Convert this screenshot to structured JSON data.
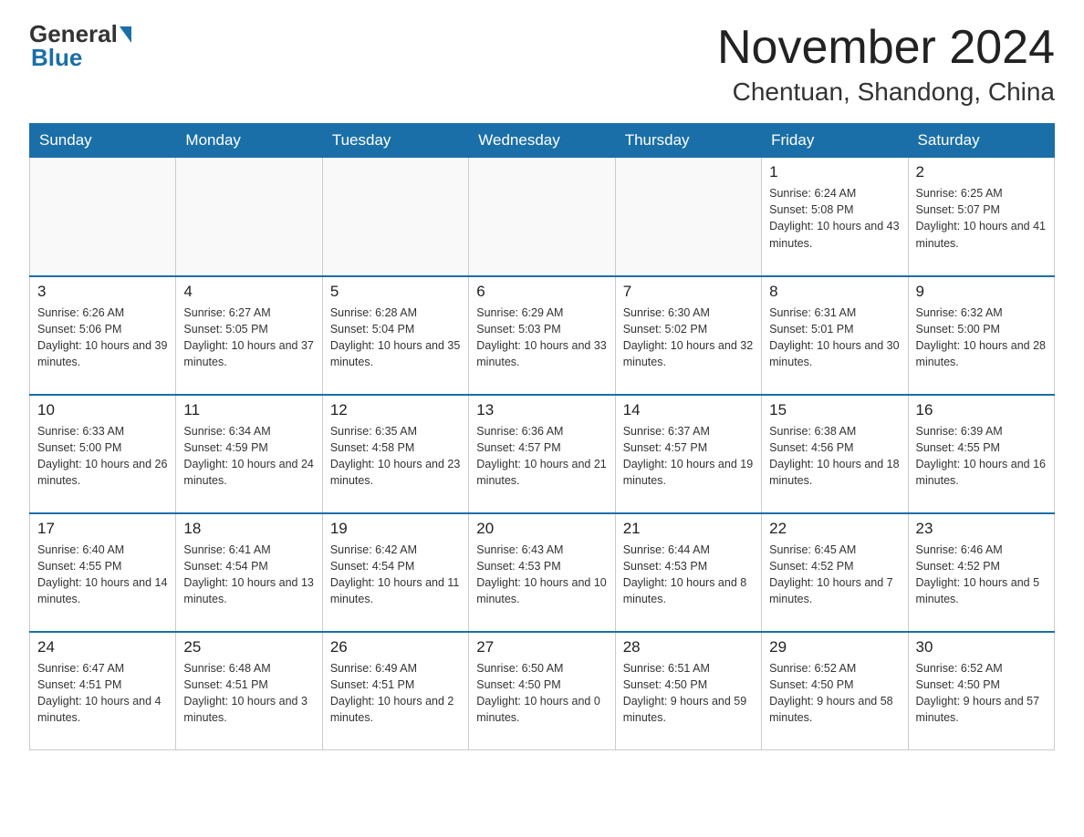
{
  "header": {
    "logo_general": "General",
    "logo_blue": "Blue",
    "title": "November 2024",
    "subtitle": "Chentuan, Shandong, China"
  },
  "calendar": {
    "days_of_week": [
      "Sunday",
      "Monday",
      "Tuesday",
      "Wednesday",
      "Thursday",
      "Friday",
      "Saturday"
    ],
    "weeks": [
      [
        {
          "day": "",
          "info": ""
        },
        {
          "day": "",
          "info": ""
        },
        {
          "day": "",
          "info": ""
        },
        {
          "day": "",
          "info": ""
        },
        {
          "day": "",
          "info": ""
        },
        {
          "day": "1",
          "info": "Sunrise: 6:24 AM\nSunset: 5:08 PM\nDaylight: 10 hours and 43 minutes."
        },
        {
          "day": "2",
          "info": "Sunrise: 6:25 AM\nSunset: 5:07 PM\nDaylight: 10 hours and 41 minutes."
        }
      ],
      [
        {
          "day": "3",
          "info": "Sunrise: 6:26 AM\nSunset: 5:06 PM\nDaylight: 10 hours and 39 minutes."
        },
        {
          "day": "4",
          "info": "Sunrise: 6:27 AM\nSunset: 5:05 PM\nDaylight: 10 hours and 37 minutes."
        },
        {
          "day": "5",
          "info": "Sunrise: 6:28 AM\nSunset: 5:04 PM\nDaylight: 10 hours and 35 minutes."
        },
        {
          "day": "6",
          "info": "Sunrise: 6:29 AM\nSunset: 5:03 PM\nDaylight: 10 hours and 33 minutes."
        },
        {
          "day": "7",
          "info": "Sunrise: 6:30 AM\nSunset: 5:02 PM\nDaylight: 10 hours and 32 minutes."
        },
        {
          "day": "8",
          "info": "Sunrise: 6:31 AM\nSunset: 5:01 PM\nDaylight: 10 hours and 30 minutes."
        },
        {
          "day": "9",
          "info": "Sunrise: 6:32 AM\nSunset: 5:00 PM\nDaylight: 10 hours and 28 minutes."
        }
      ],
      [
        {
          "day": "10",
          "info": "Sunrise: 6:33 AM\nSunset: 5:00 PM\nDaylight: 10 hours and 26 minutes."
        },
        {
          "day": "11",
          "info": "Sunrise: 6:34 AM\nSunset: 4:59 PM\nDaylight: 10 hours and 24 minutes."
        },
        {
          "day": "12",
          "info": "Sunrise: 6:35 AM\nSunset: 4:58 PM\nDaylight: 10 hours and 23 minutes."
        },
        {
          "day": "13",
          "info": "Sunrise: 6:36 AM\nSunset: 4:57 PM\nDaylight: 10 hours and 21 minutes."
        },
        {
          "day": "14",
          "info": "Sunrise: 6:37 AM\nSunset: 4:57 PM\nDaylight: 10 hours and 19 minutes."
        },
        {
          "day": "15",
          "info": "Sunrise: 6:38 AM\nSunset: 4:56 PM\nDaylight: 10 hours and 18 minutes."
        },
        {
          "day": "16",
          "info": "Sunrise: 6:39 AM\nSunset: 4:55 PM\nDaylight: 10 hours and 16 minutes."
        }
      ],
      [
        {
          "day": "17",
          "info": "Sunrise: 6:40 AM\nSunset: 4:55 PM\nDaylight: 10 hours and 14 minutes."
        },
        {
          "day": "18",
          "info": "Sunrise: 6:41 AM\nSunset: 4:54 PM\nDaylight: 10 hours and 13 minutes."
        },
        {
          "day": "19",
          "info": "Sunrise: 6:42 AM\nSunset: 4:54 PM\nDaylight: 10 hours and 11 minutes."
        },
        {
          "day": "20",
          "info": "Sunrise: 6:43 AM\nSunset: 4:53 PM\nDaylight: 10 hours and 10 minutes."
        },
        {
          "day": "21",
          "info": "Sunrise: 6:44 AM\nSunset: 4:53 PM\nDaylight: 10 hours and 8 minutes."
        },
        {
          "day": "22",
          "info": "Sunrise: 6:45 AM\nSunset: 4:52 PM\nDaylight: 10 hours and 7 minutes."
        },
        {
          "day": "23",
          "info": "Sunrise: 6:46 AM\nSunset: 4:52 PM\nDaylight: 10 hours and 5 minutes."
        }
      ],
      [
        {
          "day": "24",
          "info": "Sunrise: 6:47 AM\nSunset: 4:51 PM\nDaylight: 10 hours and 4 minutes."
        },
        {
          "day": "25",
          "info": "Sunrise: 6:48 AM\nSunset: 4:51 PM\nDaylight: 10 hours and 3 minutes."
        },
        {
          "day": "26",
          "info": "Sunrise: 6:49 AM\nSunset: 4:51 PM\nDaylight: 10 hours and 2 minutes."
        },
        {
          "day": "27",
          "info": "Sunrise: 6:50 AM\nSunset: 4:50 PM\nDaylight: 10 hours and 0 minutes."
        },
        {
          "day": "28",
          "info": "Sunrise: 6:51 AM\nSunset: 4:50 PM\nDaylight: 9 hours and 59 minutes."
        },
        {
          "day": "29",
          "info": "Sunrise: 6:52 AM\nSunset: 4:50 PM\nDaylight: 9 hours and 58 minutes."
        },
        {
          "day": "30",
          "info": "Sunrise: 6:52 AM\nSunset: 4:50 PM\nDaylight: 9 hours and 57 minutes."
        }
      ]
    ]
  }
}
